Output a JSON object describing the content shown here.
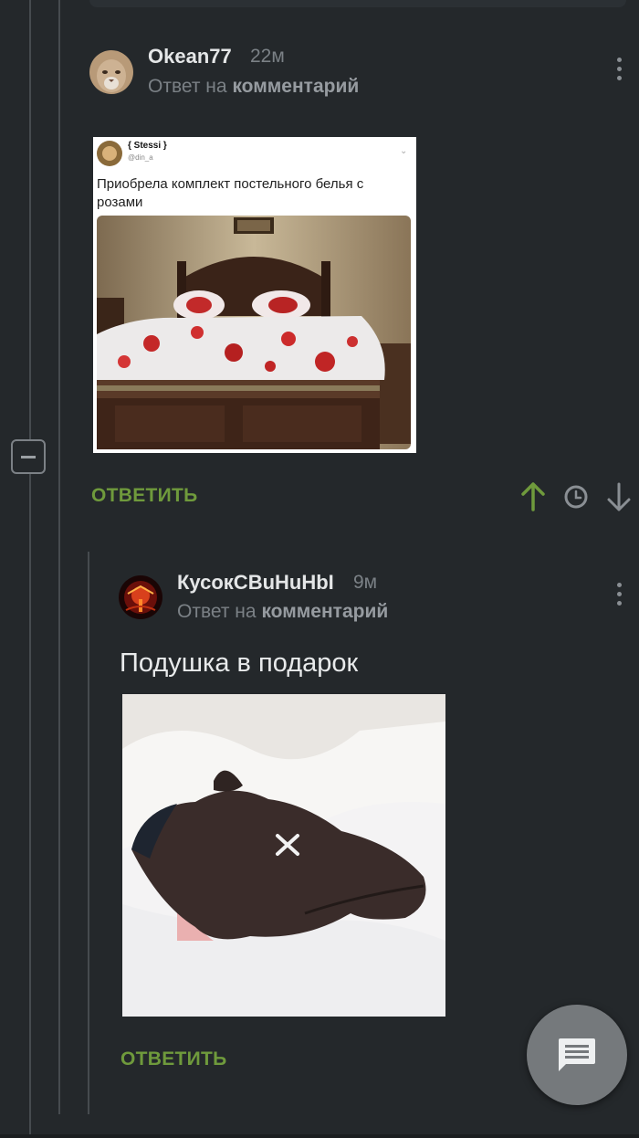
{
  "comment1": {
    "username": "Okean77",
    "time": "22м",
    "reply_prefix": "Ответ на",
    "reply_link": "комментарий",
    "embedded_post": {
      "author_name": "{ Stessi }",
      "author_handle": "@din_a",
      "text_line1": "Приобрела комплект постельного белья с",
      "text_line2": "розами"
    },
    "reply_label": "ОТВЕТИТЬ"
  },
  "comment2": {
    "username": "КусокСВuHuHbI",
    "time": "9м",
    "reply_prefix": "Ответ на",
    "reply_link": "комментарий",
    "text": "Подушка в подарок",
    "reply_label": "ОТВЕТИТЬ"
  },
  "colors": {
    "background": "#24282b",
    "accent_green": "#6f9a3c",
    "muted_text": "#7b8186"
  },
  "icons": {
    "upvote": "arrow-up-icon",
    "history": "clock-icon",
    "downvote": "arrow-down-icon",
    "collapse": "minus-icon",
    "fab": "comment-icon"
  }
}
